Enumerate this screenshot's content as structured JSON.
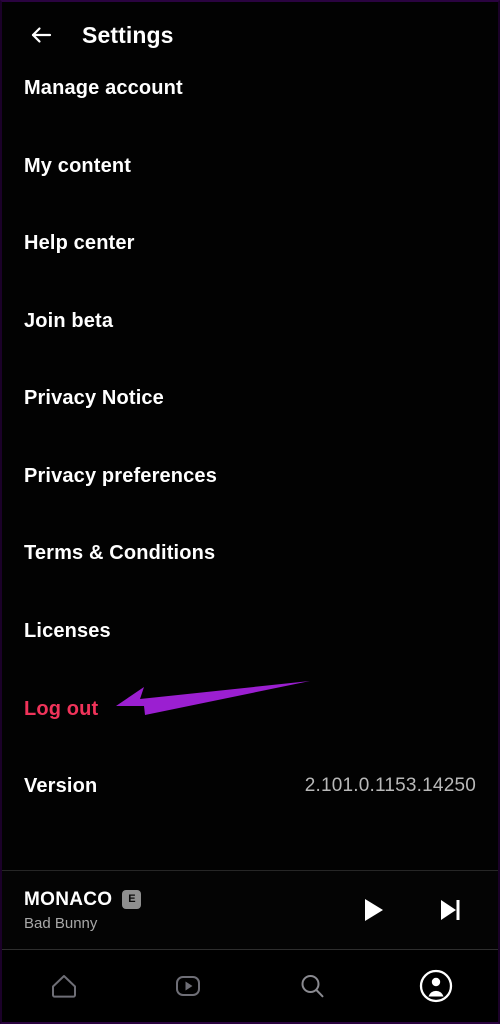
{
  "header": {
    "title": "Settings",
    "back_icon": "arrow-left-icon"
  },
  "settings": {
    "items": [
      {
        "label": "Manage account",
        "type": "link"
      },
      {
        "label": "My content",
        "type": "link"
      },
      {
        "label": "Help center",
        "type": "link"
      },
      {
        "label": "Join beta",
        "type": "link"
      },
      {
        "label": "Privacy Notice",
        "type": "link"
      },
      {
        "label": "Privacy preferences",
        "type": "link"
      },
      {
        "label": "Terms & Conditions",
        "type": "link"
      },
      {
        "label": "Licenses",
        "type": "link"
      },
      {
        "label": "Log out",
        "type": "danger"
      },
      {
        "label": "Version",
        "type": "info",
        "value": "2.101.0.1153.14250"
      }
    ]
  },
  "annotation": {
    "kind": "arrow",
    "points_to": "Log out",
    "color": "#9b1fd1"
  },
  "now_playing": {
    "title": "MONACO",
    "explicit_badge": "E",
    "artist": "Bad Bunny",
    "controls": [
      {
        "name": "play-button",
        "icon": "play-icon"
      },
      {
        "name": "next-track-button",
        "icon": "skip-next-icon"
      }
    ]
  },
  "bottom_nav": {
    "items": [
      {
        "name": "home",
        "icon": "home-icon",
        "active": false
      },
      {
        "name": "videos",
        "icon": "video-play-icon",
        "active": false
      },
      {
        "name": "search",
        "icon": "search-icon",
        "active": false
      },
      {
        "name": "profile",
        "icon": "account-circle-icon",
        "active": true
      }
    ]
  },
  "colors": {
    "background": "#020202",
    "text": "#ffffff",
    "muted": "#b9b9b9",
    "danger": "#f0335a",
    "annotation": "#9b1fd1",
    "nav_inactive": "#6e6e76",
    "nav_active": "#ffffff"
  }
}
